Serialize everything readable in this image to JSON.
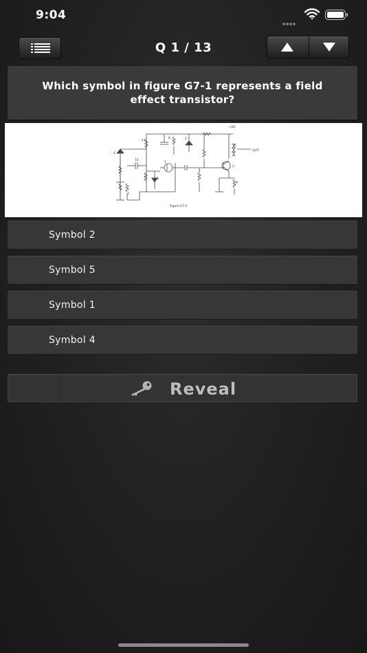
{
  "status_bar": {
    "time": "9:04"
  },
  "nav": {
    "question_counter": "Q 1 / 13"
  },
  "question": {
    "text": "Which symbol in figure G7-1 represents a field effect transistor?"
  },
  "figure": {
    "caption": "Figure G7-1",
    "labels": {
      "vdc": "+DC",
      "out": "OUT",
      "n1": "1",
      "n2": "2",
      "n3": "3",
      "n4": "4",
      "n5": "5",
      "n6": "6",
      "n7": "7",
      "n8": "8",
      "n9": "9",
      "n10": "10",
      "n11": "11"
    }
  },
  "answers": [
    {
      "label": "Symbol 2"
    },
    {
      "label": "Symbol 5"
    },
    {
      "label": "Symbol 1"
    },
    {
      "label": "Symbol 4"
    }
  ],
  "reveal": {
    "label": "Reveal"
  },
  "colors": {
    "background": "#222222",
    "panel": "#3a3a3a",
    "answer": "#373737",
    "reveal_text": "#bdbdbd"
  },
  "icons": [
    "menu-list-icon",
    "arrow-up-icon",
    "arrow-down-icon",
    "key-icon",
    "wifi-icon",
    "battery-icon"
  ]
}
